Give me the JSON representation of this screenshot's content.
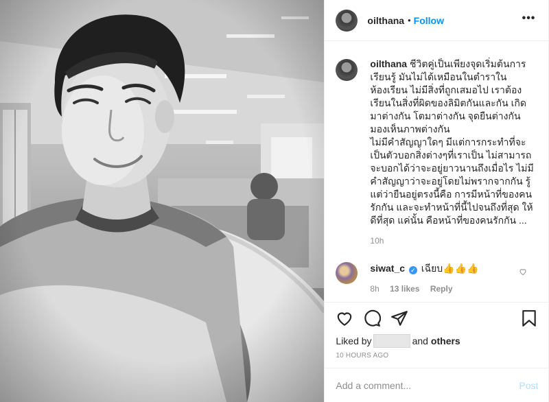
{
  "post": {
    "username": "oilthana",
    "dot": "•",
    "follow_label": "Follow",
    "more_label": "•••"
  },
  "caption": {
    "username": "oilthana",
    "text": "ชีวิตคู่เป็นเพียงจุดเริ่มต้นการเรียนรู้ มันไม่ได้เหมือนในตำราในห้องเรียน ไม่มีสิ่งที่ถูกเสมอไป เราต้องเรียนในสิ่งที่ผิดของลิมิตกันและกัน เกิดมาต่างกัน โตมาต่างกัน จุดยืนต่างกัน มองเห็นภาพต่างกัน\nไม่มีคำสัญญาใดๆ มีแต่การกระทำที่จะเป็นตัวบอกสิ่งต่างๆที่เราเป็น ไม่สามารถจะบอกได้ว่าจะอยู่ยาวนานถึงเมื่อไร ไม่มีคำสัญญาว่าจะอยู่โดยไม่พรากจากกัน รู้แต่ว่ายืนอยู่ตรงนี้คือ การมีหน้าที่ของคนรักกัน และจะทำหน้าที่นี้ไปจนถึงที่สุด ให้ดีที่สุด แค่นั้น คือหน้าที่ของคนรักกัน ...",
    "time": "10h"
  },
  "comment": {
    "username": "siwat_c",
    "verified_mark": "✓",
    "text": "เฉียบ👍👍👍",
    "time": "8h",
    "likes": "13 likes",
    "reply_label": "Reply"
  },
  "actions": {
    "icons": [
      "heart-icon",
      "comment-icon",
      "share-icon",
      "bookmark-icon"
    ],
    "liked_by_prefix": "Liked by",
    "liked_by_suffix": "and",
    "liked_by_others": "others",
    "timestamp": "10 HOURS AGO"
  },
  "add_comment": {
    "placeholder": "Add a comment...",
    "post_label": "Post"
  },
  "colors": {
    "accent": "#0095f6",
    "post_disabled": "#b2dffc",
    "muted": "#8e8e8e",
    "text": "#262626"
  }
}
